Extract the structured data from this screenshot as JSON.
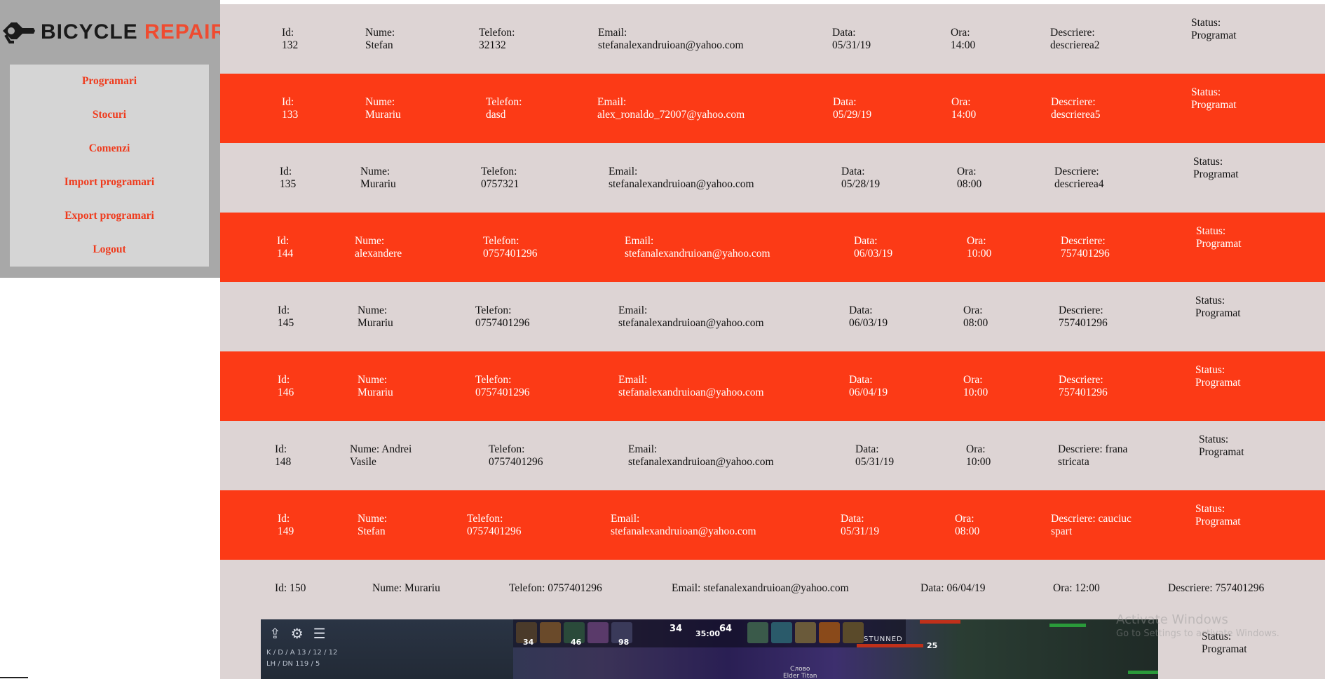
{
  "app": {
    "logo_word1": "BICYCLE",
    "logo_word2": "REPAIR",
    "accent_color": "#fc3a16",
    "light_row_color": "#ddd4d4"
  },
  "menu": [
    {
      "label": "Programari"
    },
    {
      "label": "Stocuri"
    },
    {
      "label": "Comenzi"
    },
    {
      "label": "Import programari"
    },
    {
      "label": "Export programari"
    },
    {
      "label": "Logout"
    }
  ],
  "rows": [
    {
      "id": "Id:\n132",
      "nume": "Nume:\nStefan",
      "telefon": "Telefon:\n32132",
      "email": "Email:\nstefanalexandruioan@yahoo.com",
      "data": "Data:\n05/31/19",
      "ora": "Ora:\n14:00",
      "descriere": "Descriere:\ndescrierea2",
      "status": "Status:\nProgramat"
    },
    {
      "id": "Id:\n133",
      "nume": "Nume:\nMurariu",
      "telefon": "Telefon:\ndasd",
      "email": "Email:\nalex_ronaldo_72007@yahoo.com",
      "data": "Data:\n05/29/19",
      "ora": "Ora:\n14:00",
      "descriere": "Descriere:\ndescrierea5",
      "status": "Status:\nProgramat"
    },
    {
      "id": "Id:\n135",
      "nume": "Nume:\nMurariu",
      "telefon": "Telefon:\n0757321",
      "email": "Email:\nstefanalexandruioan@yahoo.com",
      "data": "Data:\n05/28/19",
      "ora": "Ora:\n08:00",
      "descriere": "Descriere:\ndescrierea4",
      "status": "Status:\nProgramat"
    },
    {
      "id": "Id:\n144",
      "nume": "Nume:\nalexandere",
      "telefon": "Telefon:\n0757401296",
      "email": "Email:\nstefanalexandruioan@yahoo.com",
      "data": "Data:\n06/03/19",
      "ora": "Ora:\n10:00",
      "descriere": "Descriere:\n757401296",
      "status": "Status:\nProgramat"
    },
    {
      "id": "Id:\n145",
      "nume": "Nume:\nMurariu",
      "telefon": "Telefon:\n0757401296",
      "email": "Email:\nstefanalexandruioan@yahoo.com",
      "data": "Data:\n06/03/19",
      "ora": "Ora:\n08:00",
      "descriere": "Descriere:\n757401296",
      "status": "Status:\nProgramat"
    },
    {
      "id": "Id:\n146",
      "nume": "Nume:\nMurariu",
      "telefon": "Telefon:\n0757401296",
      "email": "Email:\nstefanalexandruioan@yahoo.com",
      "data": "Data:\n06/04/19",
      "ora": "Ora:\n10:00",
      "descriere": "Descriere:\n757401296",
      "status": "Status:\nProgramat"
    },
    {
      "id": "Id:\n148",
      "nume": "Nume: Andrei\nVasile",
      "telefon": "Telefon:\n0757401296",
      "email": "Email:\nstefanalexandruioan@yahoo.com",
      "data": "Data:\n05/31/19",
      "ora": "Ora:\n10:00",
      "descriere": "Descriere: frana\nstricata",
      "status": "Status:\nProgramat"
    },
    {
      "id": "Id:\n149",
      "nume": "Nume:\nStefan",
      "telefon": "Telefon:\n0757401296",
      "email": "Email:\nstefanalexandruioan@yahoo.com",
      "data": "Data:\n05/31/19",
      "ora": "Ora:\n08:00",
      "descriere": "Descriere: cauciuc\nspart",
      "status": "Status:\nProgramat"
    },
    {
      "id": "Id: 150",
      "nume": "Nume: Murariu",
      "telefon": "Telefon: 0757401296",
      "email": "Email: stefanalexandruioan@yahoo.com",
      "data": "Data: 06/04/19",
      "ora": "Ora: 12:00",
      "descriere": "Descriere: 757401296",
      "status": "Status:\nProgramat"
    }
  ],
  "overlay": {
    "stats": "K / D / A   13 / 12 / 12\nLH / DN   119 / 5",
    "nums": [
      "34",
      "46",
      "98"
    ],
    "score_left": "34",
    "clock": "35:00",
    "score_right": "64",
    "stunned": "STUNNED",
    "level": "25",
    "caption": "Слово\nElder Titan"
  },
  "watermark": {
    "line1": "Activate Windows",
    "line2": "Go to Settings to activate Windows."
  }
}
